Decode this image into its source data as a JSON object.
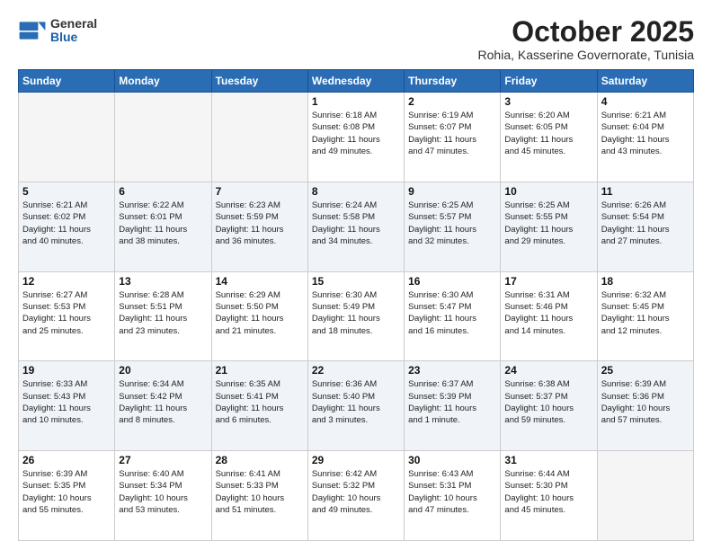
{
  "header": {
    "logo": {
      "general": "General",
      "blue": "Blue"
    },
    "month": "October 2025",
    "location": "Rohia, Kasserine Governorate, Tunisia"
  },
  "weekdays": [
    "Sunday",
    "Monday",
    "Tuesday",
    "Wednesday",
    "Thursday",
    "Friday",
    "Saturday"
  ],
  "rows": [
    {
      "cells": [
        {
          "day": "",
          "text": ""
        },
        {
          "day": "",
          "text": ""
        },
        {
          "day": "",
          "text": ""
        },
        {
          "day": "1",
          "text": "Sunrise: 6:18 AM\nSunset: 6:08 PM\nDaylight: 11 hours\nand 49 minutes."
        },
        {
          "day": "2",
          "text": "Sunrise: 6:19 AM\nSunset: 6:07 PM\nDaylight: 11 hours\nand 47 minutes."
        },
        {
          "day": "3",
          "text": "Sunrise: 6:20 AM\nSunset: 6:05 PM\nDaylight: 11 hours\nand 45 minutes."
        },
        {
          "day": "4",
          "text": "Sunrise: 6:21 AM\nSunset: 6:04 PM\nDaylight: 11 hours\nand 43 minutes."
        }
      ],
      "alt": false
    },
    {
      "cells": [
        {
          "day": "5",
          "text": "Sunrise: 6:21 AM\nSunset: 6:02 PM\nDaylight: 11 hours\nand 40 minutes."
        },
        {
          "day": "6",
          "text": "Sunrise: 6:22 AM\nSunset: 6:01 PM\nDaylight: 11 hours\nand 38 minutes."
        },
        {
          "day": "7",
          "text": "Sunrise: 6:23 AM\nSunset: 5:59 PM\nDaylight: 11 hours\nand 36 minutes."
        },
        {
          "day": "8",
          "text": "Sunrise: 6:24 AM\nSunset: 5:58 PM\nDaylight: 11 hours\nand 34 minutes."
        },
        {
          "day": "9",
          "text": "Sunrise: 6:25 AM\nSunset: 5:57 PM\nDaylight: 11 hours\nand 32 minutes."
        },
        {
          "day": "10",
          "text": "Sunrise: 6:25 AM\nSunset: 5:55 PM\nDaylight: 11 hours\nand 29 minutes."
        },
        {
          "day": "11",
          "text": "Sunrise: 6:26 AM\nSunset: 5:54 PM\nDaylight: 11 hours\nand 27 minutes."
        }
      ],
      "alt": true
    },
    {
      "cells": [
        {
          "day": "12",
          "text": "Sunrise: 6:27 AM\nSunset: 5:53 PM\nDaylight: 11 hours\nand 25 minutes."
        },
        {
          "day": "13",
          "text": "Sunrise: 6:28 AM\nSunset: 5:51 PM\nDaylight: 11 hours\nand 23 minutes."
        },
        {
          "day": "14",
          "text": "Sunrise: 6:29 AM\nSunset: 5:50 PM\nDaylight: 11 hours\nand 21 minutes."
        },
        {
          "day": "15",
          "text": "Sunrise: 6:30 AM\nSunset: 5:49 PM\nDaylight: 11 hours\nand 18 minutes."
        },
        {
          "day": "16",
          "text": "Sunrise: 6:30 AM\nSunset: 5:47 PM\nDaylight: 11 hours\nand 16 minutes."
        },
        {
          "day": "17",
          "text": "Sunrise: 6:31 AM\nSunset: 5:46 PM\nDaylight: 11 hours\nand 14 minutes."
        },
        {
          "day": "18",
          "text": "Sunrise: 6:32 AM\nSunset: 5:45 PM\nDaylight: 11 hours\nand 12 minutes."
        }
      ],
      "alt": false
    },
    {
      "cells": [
        {
          "day": "19",
          "text": "Sunrise: 6:33 AM\nSunset: 5:43 PM\nDaylight: 11 hours\nand 10 minutes."
        },
        {
          "day": "20",
          "text": "Sunrise: 6:34 AM\nSunset: 5:42 PM\nDaylight: 11 hours\nand 8 minutes."
        },
        {
          "day": "21",
          "text": "Sunrise: 6:35 AM\nSunset: 5:41 PM\nDaylight: 11 hours\nand 6 minutes."
        },
        {
          "day": "22",
          "text": "Sunrise: 6:36 AM\nSunset: 5:40 PM\nDaylight: 11 hours\nand 3 minutes."
        },
        {
          "day": "23",
          "text": "Sunrise: 6:37 AM\nSunset: 5:39 PM\nDaylight: 11 hours\nand 1 minute."
        },
        {
          "day": "24",
          "text": "Sunrise: 6:38 AM\nSunset: 5:37 PM\nDaylight: 10 hours\nand 59 minutes."
        },
        {
          "day": "25",
          "text": "Sunrise: 6:39 AM\nSunset: 5:36 PM\nDaylight: 10 hours\nand 57 minutes."
        }
      ],
      "alt": true
    },
    {
      "cells": [
        {
          "day": "26",
          "text": "Sunrise: 6:39 AM\nSunset: 5:35 PM\nDaylight: 10 hours\nand 55 minutes."
        },
        {
          "day": "27",
          "text": "Sunrise: 6:40 AM\nSunset: 5:34 PM\nDaylight: 10 hours\nand 53 minutes."
        },
        {
          "day": "28",
          "text": "Sunrise: 6:41 AM\nSunset: 5:33 PM\nDaylight: 10 hours\nand 51 minutes."
        },
        {
          "day": "29",
          "text": "Sunrise: 6:42 AM\nSunset: 5:32 PM\nDaylight: 10 hours\nand 49 minutes."
        },
        {
          "day": "30",
          "text": "Sunrise: 6:43 AM\nSunset: 5:31 PM\nDaylight: 10 hours\nand 47 minutes."
        },
        {
          "day": "31",
          "text": "Sunrise: 6:44 AM\nSunset: 5:30 PM\nDaylight: 10 hours\nand 45 minutes."
        },
        {
          "day": "",
          "text": ""
        }
      ],
      "alt": false
    }
  ]
}
